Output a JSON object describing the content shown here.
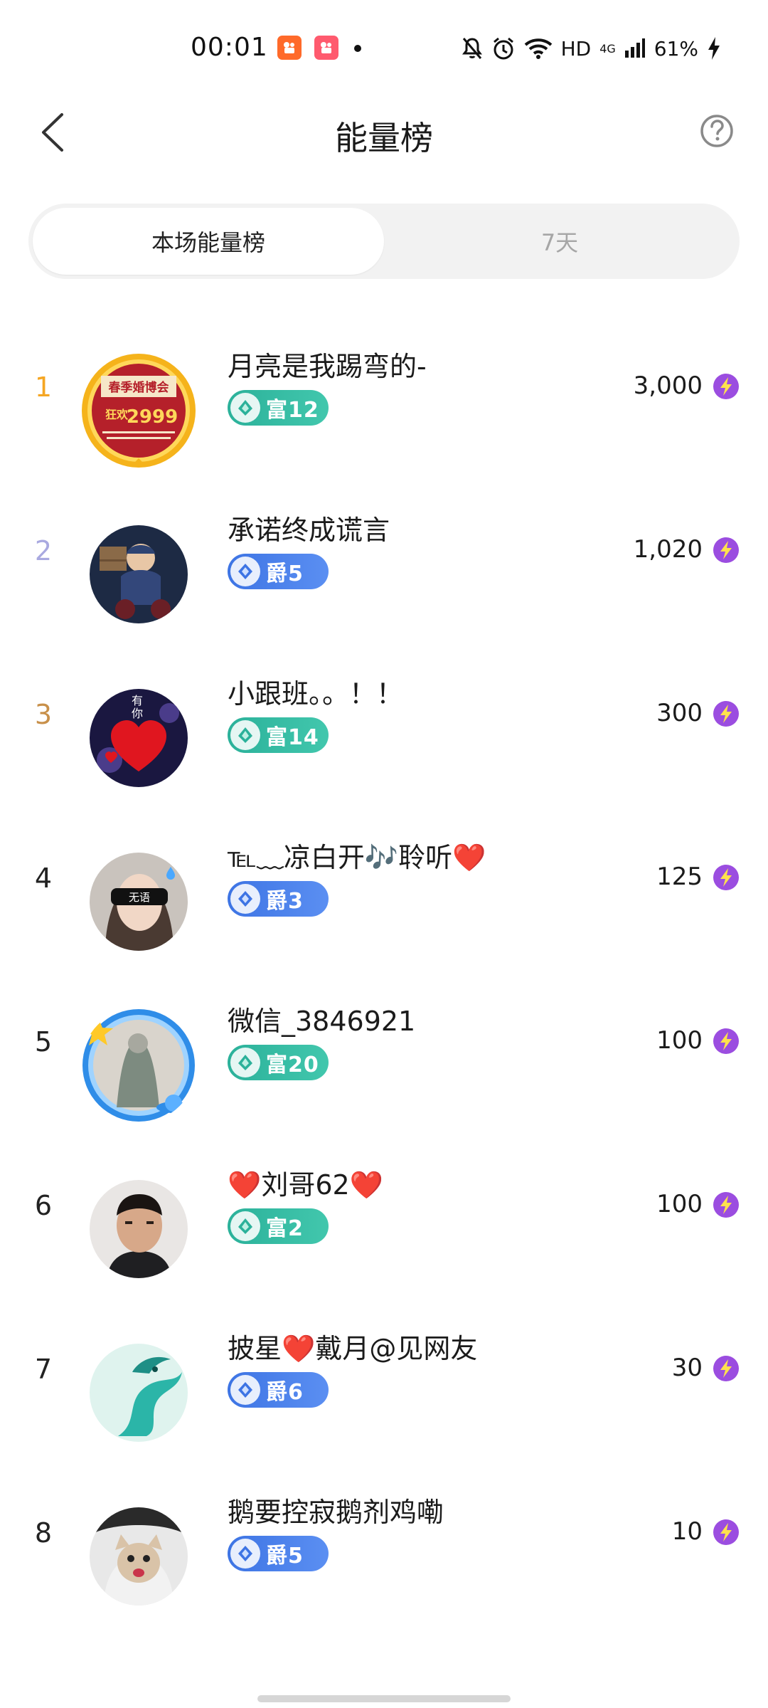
{
  "status_bar": {
    "time": "00:01",
    "network": "HD",
    "network_gen": "4G",
    "battery": "61%",
    "icons": [
      "kuaishou-app-icon",
      "kuaishou-app-icon",
      "notification-dot",
      "mute-icon",
      "alarm-icon",
      "wifi-icon",
      "signal-icon",
      "charging-icon"
    ]
  },
  "header": {
    "title": "能量榜",
    "back_icon": "chevron-left-icon",
    "help_icon": "question-mark-icon"
  },
  "tabs": [
    {
      "label": "本场能量榜",
      "active": true
    },
    {
      "label": "7天",
      "active": false
    }
  ],
  "rank_colors": {
    "1": "#f5a623",
    "2": "#a9a9e0",
    "3": "#c8904a"
  },
  "rankings": [
    {
      "rank": "1",
      "name": "月亮是我踢弯的-",
      "badge_type": "fu",
      "badge": "富12",
      "score": "3,000"
    },
    {
      "rank": "2",
      "name": "承诺终成谎言",
      "badge_type": "jue",
      "badge": "爵5",
      "score": "1,020"
    },
    {
      "rank": "3",
      "name": "小跟班。。！！",
      "badge_type": "fu",
      "badge": "富14",
      "score": "300"
    },
    {
      "rank": "4",
      "name": "℡﹏凉白开🎶聆听❤️",
      "badge_type": "jue",
      "badge": "爵3",
      "score": "125"
    },
    {
      "rank": "5",
      "name": "微信_3846921",
      "badge_type": "fu",
      "badge": "富20",
      "score": "100"
    },
    {
      "rank": "6",
      "name": "❤️刘哥62❤️",
      "badge_type": "fu",
      "badge": "富2",
      "score": "100"
    },
    {
      "rank": "7",
      "name": "披星❤️戴月@见网友",
      "badge_type": "jue",
      "badge": "爵6",
      "score": "30"
    },
    {
      "rank": "8",
      "name": "鹅要控寂鹅剂鸡嘞",
      "badge_type": "jue",
      "badge": "爵5",
      "score": "10"
    }
  ],
  "avatar_1_text": {
    "top": "春季婚博会",
    "promo": "狂欢",
    "price": "2999"
  },
  "avatar_3_text": {
    "top": "有",
    "bottom": "你"
  },
  "avatar_4_text": "无语"
}
